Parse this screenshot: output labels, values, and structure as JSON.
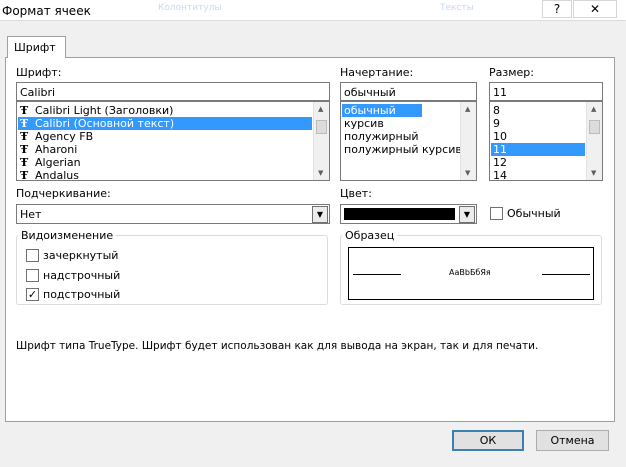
{
  "window": {
    "title": "Формат ячеек",
    "help_glyph": "?",
    "close_glyph": "✕",
    "faint_1": "Колонтитулы",
    "faint_2": "Тексты"
  },
  "tabs": [
    {
      "label": "Шрифт"
    }
  ],
  "font": {
    "label": "Шрифт:",
    "value": "Calibri",
    "items": [
      {
        "label": "Calibri Light (Заголовки)",
        "icon": "truetype-icon"
      },
      {
        "label": "Calibri (Основной текст)",
        "icon": "truetype-icon",
        "selected": true
      },
      {
        "label": "Agency FB",
        "icon": "truetype-icon"
      },
      {
        "label": "Aharoni",
        "icon": "truetype-icon"
      },
      {
        "label": "Algerian",
        "icon": "truetype-icon"
      },
      {
        "label": "Andalus",
        "icon": "truetype-icon"
      }
    ]
  },
  "style": {
    "label": "Начертание:",
    "value": "обычный",
    "items": [
      {
        "label": "обычный",
        "selected": true
      },
      {
        "label": "курсив"
      },
      {
        "label": "полужирный"
      },
      {
        "label": "полужирный курсив"
      }
    ]
  },
  "size": {
    "label": "Размер:",
    "value": "11",
    "items": [
      {
        "label": "8"
      },
      {
        "label": "9"
      },
      {
        "label": "10"
      },
      {
        "label": "11",
        "selected": true
      },
      {
        "label": "12"
      },
      {
        "label": "14"
      }
    ]
  },
  "underline": {
    "label": "Подчеркивание:",
    "value": "Нет"
  },
  "color": {
    "label": "Цвет:",
    "value": "#000000"
  },
  "normal_font": {
    "label": "Обычный",
    "checked": false
  },
  "effects": {
    "title": "Видоизменение",
    "items": [
      {
        "label": "зачеркнутый",
        "checked": false
      },
      {
        "label": "надстрочный",
        "checked": false
      },
      {
        "label": "подстрочный",
        "checked": true
      }
    ]
  },
  "preview": {
    "title": "Образец",
    "text": "АаВbБбЯя"
  },
  "note": "Шрифт типа TrueType. Шрифт будет использован как для вывода на экран, так и для печати.",
  "buttons": {
    "ok": "ОК",
    "cancel": "Отмена"
  },
  "icons": {
    "truetype": "Ŧ",
    "scroll_up": "▲",
    "scroll_down": "▼",
    "dropdown": "▼",
    "checkmark": "✓"
  },
  "colors": {
    "selection": "#3399ff",
    "dialog_bg": "#f0f0f0",
    "default_button_border": "#3c7fb1"
  }
}
